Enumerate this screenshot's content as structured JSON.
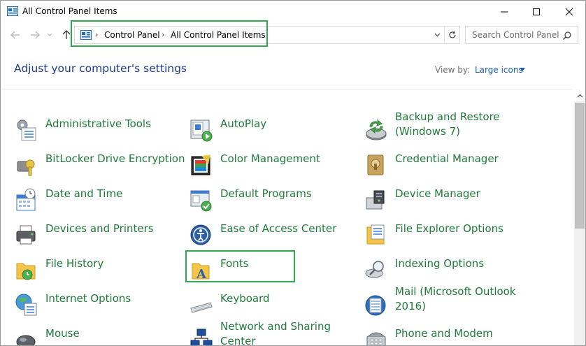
{
  "window": {
    "title": "All Control Panel Items"
  },
  "address": {
    "crumbs": [
      "Control Panel",
      "All Control Panel Items"
    ]
  },
  "search": {
    "placeholder": "Search Control Panel"
  },
  "header": {
    "title": "Adjust your computer's settings",
    "view_by_label": "View by:",
    "view_by_value": "Large icons"
  },
  "items": [
    {
      "label": "Administrative Tools",
      "icon": "admin-tools-icon"
    },
    {
      "label": "AutoPlay",
      "icon": "autoplay-icon"
    },
    {
      "label": "Backup and Restore",
      "label2": "(Windows 7)",
      "icon": "backup-restore-icon"
    },
    {
      "label": "BitLocker Drive Encryption",
      "icon": "bitlocker-icon"
    },
    {
      "label": "Color Management",
      "icon": "color-management-icon"
    },
    {
      "label": "Credential Manager",
      "icon": "credential-manager-icon"
    },
    {
      "label": "Date and Time",
      "icon": "date-time-icon"
    },
    {
      "label": "Default Programs",
      "icon": "default-programs-icon"
    },
    {
      "label": "Device Manager",
      "icon": "device-manager-icon"
    },
    {
      "label": "Devices and Printers",
      "icon": "printer-icon"
    },
    {
      "label": "Ease of Access Center",
      "icon": "ease-of-access-icon"
    },
    {
      "label": "File Explorer Options",
      "icon": "file-explorer-options-icon"
    },
    {
      "label": "File History",
      "icon": "file-history-icon"
    },
    {
      "label": "Fonts",
      "icon": "fonts-icon"
    },
    {
      "label": "Indexing Options",
      "icon": "indexing-options-icon"
    },
    {
      "label": "Internet Options",
      "icon": "internet-options-icon"
    },
    {
      "label": "Keyboard",
      "icon": "keyboard-icon"
    },
    {
      "label": "Mail (Microsoft Outlook",
      "label2": "2016)",
      "icon": "mail-icon"
    },
    {
      "label": "Mouse",
      "icon": "mouse-icon"
    },
    {
      "label": "Network and Sharing",
      "label2": "Center",
      "icon": "network-sharing-icon"
    },
    {
      "label": "Phone and Modem",
      "icon": "phone-modem-icon"
    }
  ],
  "colors": {
    "link": "#1f7a3a",
    "heading": "#1c3c8c",
    "highlight": "#2fa84f"
  }
}
